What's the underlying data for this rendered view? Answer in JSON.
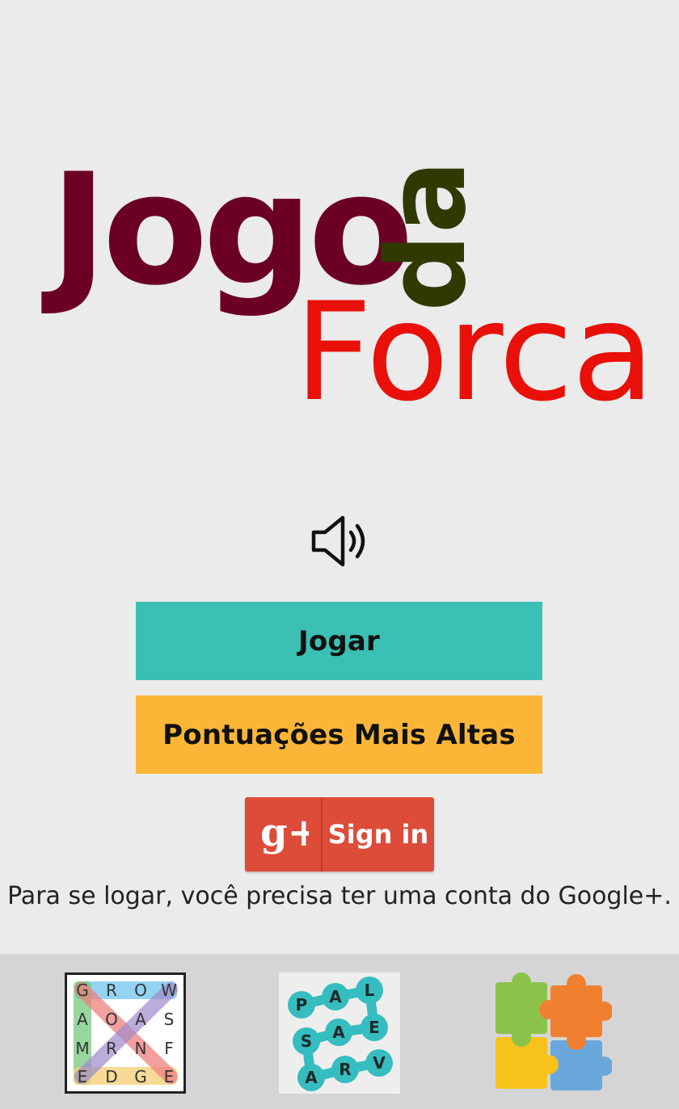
{
  "logo": {
    "line1": "Jogo",
    "line1_connector": "da",
    "line2": "Forca",
    "colors": {
      "jogo": "#6b0024",
      "da": "#2e3a00",
      "forca": "#e81009"
    }
  },
  "sound": {
    "icon": "speaker-volume-icon"
  },
  "buttons": {
    "play": "Jogar",
    "high_scores": "Pontuações Mais Altas"
  },
  "google_signin": {
    "icon_text": "g+",
    "label": "Sign in",
    "icon": "google-plus-icon"
  },
  "login_note": "Para se logar, você precisa ter uma conta do Google+.",
  "promo_apps": {
    "word_search": {
      "icon": "word-search-app-icon",
      "grid": [
        [
          "G",
          "R",
          "O",
          "W"
        ],
        [
          "A",
          "O",
          "A",
          "S"
        ],
        [
          "M",
          "R",
          "N",
          "F"
        ],
        [
          "E",
          "D",
          "G",
          "E"
        ]
      ]
    },
    "palavras": {
      "icon": "word-connect-app-icon",
      "letters": [
        "P",
        "A",
        "L",
        "S",
        "A",
        "E",
        "A",
        "R",
        "V"
      ]
    },
    "puzzle": {
      "icon": "jigsaw-puzzle-app-icon"
    }
  },
  "theme": {
    "background": "#ebebeb",
    "play_button": "#3bc0b3",
    "scores_button": "#fbb637",
    "google_red": "#dd4b39",
    "bottom_bar": "#d5d5d5"
  }
}
